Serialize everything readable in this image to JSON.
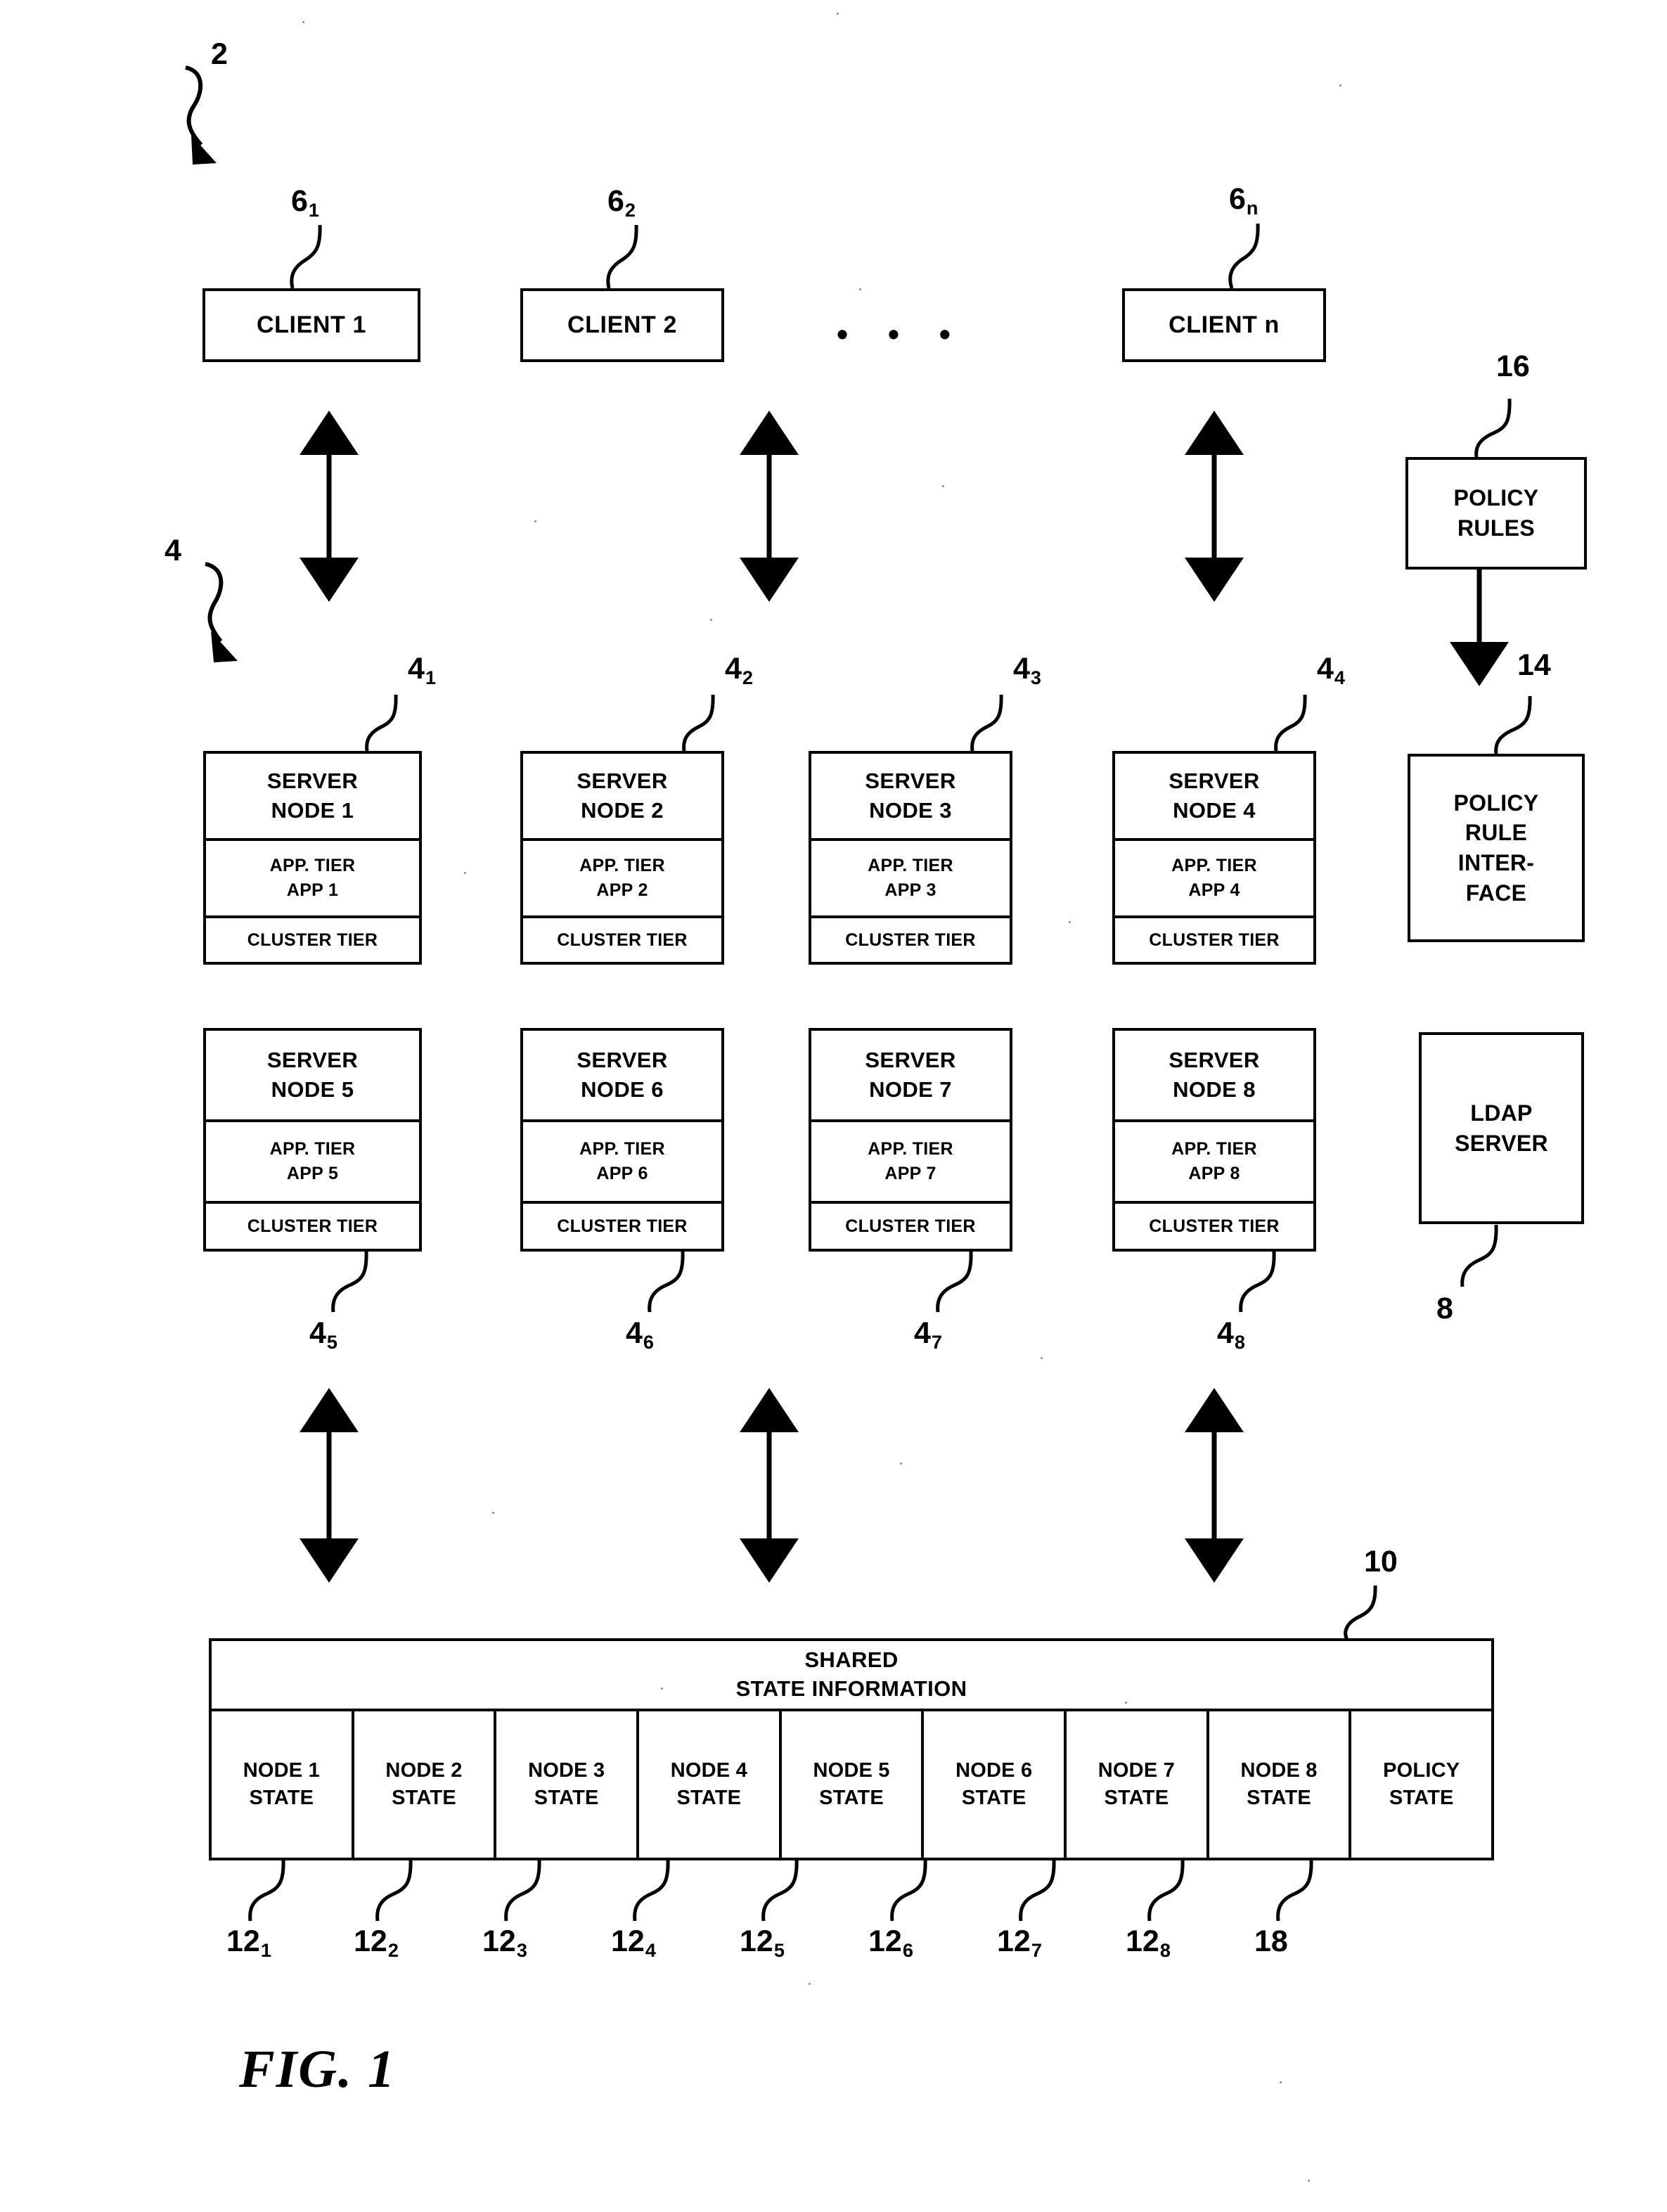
{
  "figure": {
    "caption": "FIG. 1",
    "system_ref": "2",
    "cluster_ref": "4"
  },
  "clients": {
    "items": [
      {
        "label": "CLIENT 1",
        "ref_num": "6",
        "ref_sub": "1"
      },
      {
        "label": "CLIENT 2",
        "ref_num": "6",
        "ref_sub": "2"
      },
      {
        "label": "CLIENT n",
        "ref_num": "6",
        "ref_sub": "n"
      }
    ],
    "ellipsis": "• • •"
  },
  "server_nodes": {
    "row1": [
      {
        "title_line1": "SERVER",
        "title_line2": "NODE 1",
        "app_line1": "APP. TIER",
        "app_line2": "APP 1",
        "cluster": "CLUSTER TIER",
        "ref_num": "4",
        "ref_sub": "1"
      },
      {
        "title_line1": "SERVER",
        "title_line2": "NODE 2",
        "app_line1": "APP. TIER",
        "app_line2": "APP 2",
        "cluster": "CLUSTER TIER",
        "ref_num": "4",
        "ref_sub": "2"
      },
      {
        "title_line1": "SERVER",
        "title_line2": "NODE 3",
        "app_line1": "APP. TIER",
        "app_line2": "APP 3",
        "cluster": "CLUSTER TIER",
        "ref_num": "4",
        "ref_sub": "3"
      },
      {
        "title_line1": "SERVER",
        "title_line2": "NODE 4",
        "app_line1": "APP. TIER",
        "app_line2": "APP 4",
        "cluster": "CLUSTER TIER",
        "ref_num": "4",
        "ref_sub": "4"
      }
    ],
    "row2": [
      {
        "title_line1": "SERVER",
        "title_line2": "NODE 5",
        "app_line1": "APP. TIER",
        "app_line2": "APP 5",
        "cluster": "CLUSTER TIER",
        "ref_num": "4",
        "ref_sub": "5"
      },
      {
        "title_line1": "SERVER",
        "title_line2": "NODE 6",
        "app_line1": "APP. TIER",
        "app_line2": "APP 6",
        "cluster": "CLUSTER TIER",
        "ref_num": "4",
        "ref_sub": "6"
      },
      {
        "title_line1": "SERVER",
        "title_line2": "NODE 7",
        "app_line1": "APP. TIER",
        "app_line2": "APP 7",
        "cluster": "CLUSTER TIER",
        "ref_num": "4",
        "ref_sub": "7"
      },
      {
        "title_line1": "SERVER",
        "title_line2": "NODE 8",
        "app_line1": "APP. TIER",
        "app_line2": "APP 8",
        "cluster": "CLUSTER TIER",
        "ref_num": "4",
        "ref_sub": "8"
      }
    ]
  },
  "side_boxes": {
    "policy_rules": {
      "line1": "POLICY",
      "line2": "RULES",
      "ref": "16"
    },
    "policy_rule_interface": {
      "line1": "POLICY",
      "line2": "RULE",
      "line3": "INTER-",
      "line4": "FACE",
      "ref": "14"
    },
    "ldap_server": {
      "line1": "LDAP",
      "line2": "SERVER",
      "ref": "8"
    }
  },
  "shared_state": {
    "header_line1": "SHARED",
    "header_line2": "STATE INFORMATION",
    "ref": "10",
    "cells": [
      {
        "line1": "NODE 1",
        "line2": "STATE",
        "ref_num": "12",
        "ref_sub": "1"
      },
      {
        "line1": "NODE 2",
        "line2": "STATE",
        "ref_num": "12",
        "ref_sub": "2"
      },
      {
        "line1": "NODE 3",
        "line2": "STATE",
        "ref_num": "12",
        "ref_sub": "3"
      },
      {
        "line1": "NODE 4",
        "line2": "STATE",
        "ref_num": "12",
        "ref_sub": "4"
      },
      {
        "line1": "NODE 5",
        "line2": "STATE",
        "ref_num": "12",
        "ref_sub": "5"
      },
      {
        "line1": "NODE 6",
        "line2": "STATE",
        "ref_num": "12",
        "ref_sub": "6"
      },
      {
        "line1": "NODE 7",
        "line2": "STATE",
        "ref_num": "12",
        "ref_sub": "7"
      },
      {
        "line1": "NODE 8",
        "line2": "STATE",
        "ref_num": "12",
        "ref_sub": "8"
      },
      {
        "line1": "POLICY",
        "line2": "STATE",
        "ref_num": "18",
        "ref_sub": ""
      }
    ]
  },
  "colors": {
    "ink": "#000000",
    "paper": "#ffffff"
  }
}
